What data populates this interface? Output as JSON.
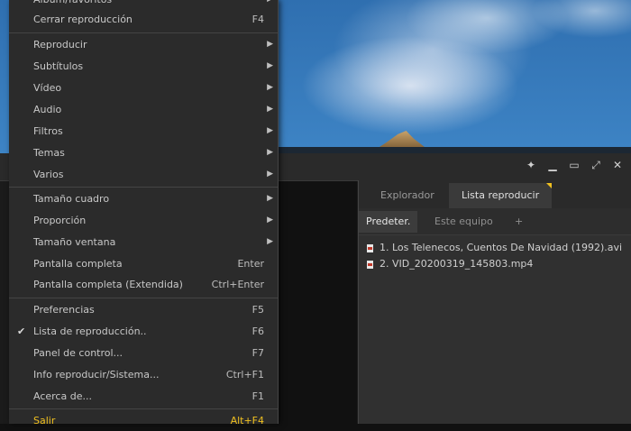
{
  "menu": {
    "top_partial": "Álbum/favoritos",
    "close_playback": {
      "label": "Cerrar reproducción",
      "shortcut": "F4"
    },
    "submenus": [
      "Reproducir",
      "Subtítulos",
      "Vídeo",
      "Audio",
      "Filtros",
      "Temas",
      "Varios"
    ],
    "size_items": [
      {
        "label": "Tamaño cuadro",
        "shortcut": "",
        "submenu": true
      },
      {
        "label": "Proporción",
        "shortcut": "",
        "submenu": true
      },
      {
        "label": "Tamaño ventana",
        "shortcut": "",
        "submenu": true
      },
      {
        "label": "Pantalla completa",
        "shortcut": "Enter",
        "submenu": false
      },
      {
        "label": "Pantalla completa (Extendida)",
        "shortcut": "Ctrl+Enter",
        "submenu": false
      }
    ],
    "tools_items": [
      {
        "label": "Preferencias",
        "shortcut": "F5",
        "checked": false
      },
      {
        "label": "Lista de reproducción..",
        "shortcut": "F6",
        "checked": true
      },
      {
        "label": "Panel de control...",
        "shortcut": "F7",
        "checked": false
      },
      {
        "label": "Info reproducir/Sistema...",
        "shortcut": "Ctrl+F1",
        "checked": false
      },
      {
        "label": "Acerca de...",
        "shortcut": "F1",
        "checked": false
      }
    ],
    "exit": {
      "label": "Salir",
      "shortcut": "Alt+F4"
    }
  },
  "panel": {
    "tabs": [
      "Explorador",
      "Lista reproducir"
    ],
    "subtabs": [
      "Predeter.",
      "Este equipo",
      "+"
    ],
    "items": [
      "1. Los Telenecos, Cuentos De Navidad (1992).avi",
      "2. VID_20200319_145803.mp4"
    ]
  },
  "icons": {
    "pin": "pin-icon",
    "minimize": "minimize-icon",
    "maximize": "maximize-icon",
    "fullscreen": "fullscreen-icon",
    "close": "close-icon",
    "submenu": "chevron-right-icon",
    "check": "check-icon",
    "file": "file-icon"
  },
  "colors": {
    "accent": "#f0c020",
    "menu_bg": "#2b2b2b",
    "panel_bg": "#303030"
  }
}
